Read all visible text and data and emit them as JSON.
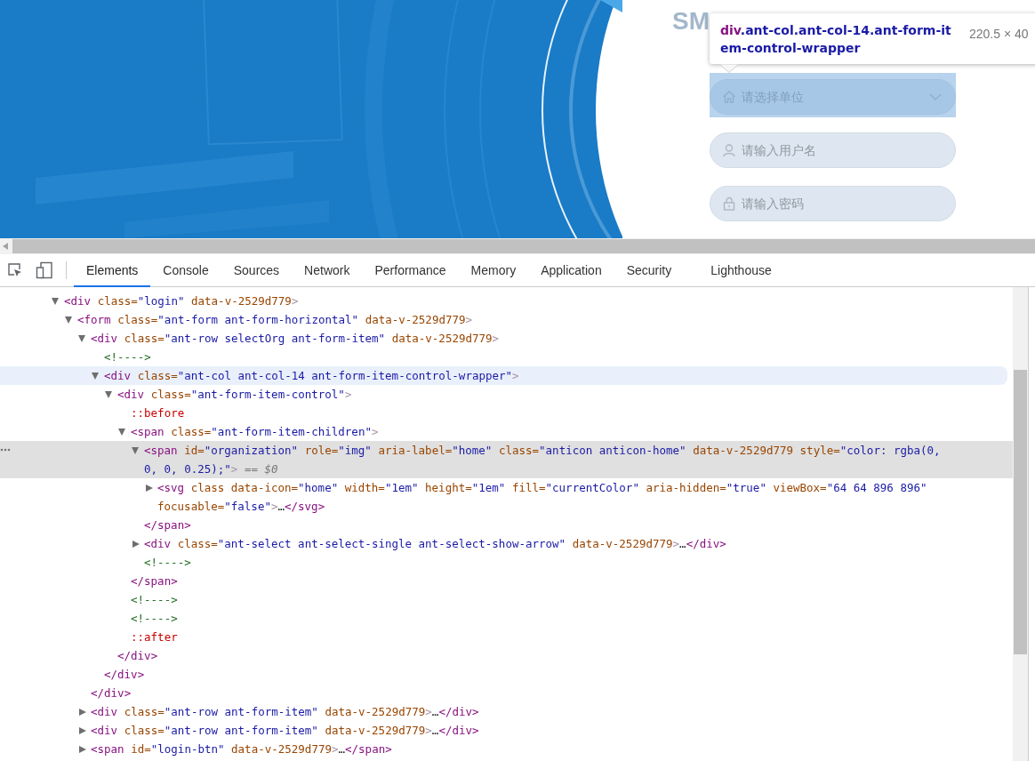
{
  "login_page": {
    "title": "SM",
    "fields": [
      {
        "kind": "select",
        "placeholder": "请选择单位"
      },
      {
        "kind": "text",
        "placeholder": "请输入用户名"
      },
      {
        "kind": "password",
        "placeholder": "请输入密码"
      }
    ]
  },
  "inspect_tooltip": {
    "tag": "div",
    "classes": ".ant-col.ant-col-14.ant-form-item-control-wrapper",
    "size": "220.5 × 40"
  },
  "devtools": {
    "tabs": [
      {
        "label": "Elements",
        "selected": true
      },
      {
        "label": "Console",
        "selected": false
      },
      {
        "label": "Sources",
        "selected": false
      },
      {
        "label": "Network",
        "selected": false
      },
      {
        "label": "Performance",
        "selected": false
      },
      {
        "label": "Memory",
        "selected": false
      },
      {
        "label": "Application",
        "selected": false
      },
      {
        "label": "Security",
        "selected": false
      },
      {
        "label": "Lighthouse",
        "selected": false
      }
    ],
    "tree": [
      {
        "expanded": true,
        "selected": false,
        "hovered": false,
        "lines": [
          [
            {
              "kind": "tag",
              "t": "<div"
            },
            {
              "kind": "attr",
              "t": " class="
            },
            {
              "kind": "val",
              "t": "\"login\""
            },
            {
              "kind": "attr",
              "t": " data-v-2529d779"
            },
            {
              "kind": "p",
              "t": ">"
            }
          ]
        ],
        "children": [
          {
            "expanded": true,
            "selected": false,
            "hovered": false,
            "lines": [
              [
                {
                  "kind": "tag",
                  "t": "<form"
                },
                {
                  "kind": "attr",
                  "t": " class="
                },
                {
                  "kind": "val",
                  "t": "\"ant-form ant-form-horizontal\""
                },
                {
                  "kind": "attr",
                  "t": " data-v-2529d779"
                },
                {
                  "kind": "p",
                  "t": ">"
                }
              ]
            ],
            "children": [
              {
                "expanded": true,
                "selected": false,
                "hovered": false,
                "lines": [
                  [
                    {
                      "kind": "tag",
                      "t": "<div"
                    },
                    {
                      "kind": "attr",
                      "t": " class="
                    },
                    {
                      "kind": "val",
                      "t": "\"ant-row selectOrg ant-form-item\""
                    },
                    {
                      "kind": "attr",
                      "t": " data-v-2529d779"
                    },
                    {
                      "kind": "p",
                      "t": ">"
                    }
                  ]
                ],
                "closing": [
                  {
                    "kind": "tag",
                    "t": "</div>"
                  }
                ],
                "children": [
                  {
                    "selected": false,
                    "hovered": false,
                    "lines": [
                      [
                        {
                          "kind": "com",
                          "t": "<!---->"
                        }
                      ]
                    ]
                  },
                  {
                    "expanded": true,
                    "selected": false,
                    "hovered": true,
                    "lines": [
                      [
                        {
                          "kind": "tag",
                          "t": "<div"
                        },
                        {
                          "kind": "attr",
                          "t": " class="
                        },
                        {
                          "kind": "val",
                          "t": "\"ant-col ant-col-14 ant-form-item-control-wrapper\""
                        },
                        {
                          "kind": "p",
                          "t": ">"
                        }
                      ]
                    ],
                    "closing": [
                      {
                        "kind": "tag",
                        "t": "</div>"
                      }
                    ],
                    "children": [
                      {
                        "expanded": true,
                        "selected": false,
                        "hovered": false,
                        "lines": [
                          [
                            {
                              "kind": "tag",
                              "t": "<div"
                            },
                            {
                              "kind": "attr",
                              "t": " class="
                            },
                            {
                              "kind": "val",
                              "t": "\"ant-form-item-control\""
                            },
                            {
                              "kind": "p",
                              "t": ">"
                            }
                          ]
                        ],
                        "closing": [
                          {
                            "kind": "tag",
                            "t": "</div>"
                          }
                        ],
                        "children": [
                          {
                            "selected": false,
                            "hovered": false,
                            "lines": [
                              [
                                {
                                  "kind": "pseudo",
                                  "t": "::before"
                                }
                              ]
                            ]
                          },
                          {
                            "expanded": true,
                            "selected": false,
                            "hovered": false,
                            "lines": [
                              [
                                {
                                  "kind": "tag",
                                  "t": "<span"
                                },
                                {
                                  "kind": "attr",
                                  "t": " class="
                                },
                                {
                                  "kind": "val",
                                  "t": "\"ant-form-item-children\""
                                },
                                {
                                  "kind": "p",
                                  "t": ">"
                                }
                              ]
                            ],
                            "closing": [
                              {
                                "kind": "tag",
                                "t": "</span>"
                              }
                            ],
                            "children": [
                              {
                                "expanded": true,
                                "selected": true,
                                "hovered": false,
                                "lines": [
                                  [
                                    {
                                      "kind": "tag",
                                      "t": "<span"
                                    },
                                    {
                                      "kind": "attr",
                                      "t": " id="
                                    },
                                    {
                                      "kind": "val",
                                      "t": "\"organization\""
                                    },
                                    {
                                      "kind": "attr",
                                      "t": " role="
                                    },
                                    {
                                      "kind": "val",
                                      "t": "\"img\""
                                    },
                                    {
                                      "kind": "attr",
                                      "t": " aria-label="
                                    },
                                    {
                                      "kind": "val",
                                      "t": "\"home\""
                                    },
                                    {
                                      "kind": "attr",
                                      "t": " class="
                                    },
                                    {
                                      "kind": "val",
                                      "t": "\"anticon anticon-home\""
                                    },
                                    {
                                      "kind": "attr",
                                      "t": " data-v-2529d779"
                                    },
                                    {
                                      "kind": "attr",
                                      "t": " style="
                                    },
                                    {
                                      "kind": "val",
                                      "t": "\"color: rgba(0,"
                                    }
                                  ],
                                  [
                                    {
                                      "kind": "val",
                                      "t": "0, 0, 0.25);\""
                                    },
                                    {
                                      "kind": "p",
                                      "t": ">"
                                    },
                                    {
                                      "kind": "ref",
                                      "t": " == $0"
                                    }
                                  ]
                                ],
                                "closing": [
                                  {
                                    "kind": "tag",
                                    "t": "</span>"
                                  }
                                ],
                                "children": [
                                  {
                                    "expanded": false,
                                    "selected": false,
                                    "hovered": false,
                                    "lines": [
                                      [
                                        {
                                          "kind": "tag",
                                          "t": "<svg"
                                        },
                                        {
                                          "kind": "attr",
                                          "t": " class data-icon="
                                        },
                                        {
                                          "kind": "val",
                                          "t": "\"home\""
                                        },
                                        {
                                          "kind": "attr",
                                          "t": " width="
                                        },
                                        {
                                          "kind": "val",
                                          "t": "\"1em\""
                                        },
                                        {
                                          "kind": "attr",
                                          "t": " height="
                                        },
                                        {
                                          "kind": "val",
                                          "t": "\"1em\""
                                        },
                                        {
                                          "kind": "attr",
                                          "t": " fill="
                                        },
                                        {
                                          "kind": "val",
                                          "t": "\"currentColor\""
                                        },
                                        {
                                          "kind": "attr",
                                          "t": " aria-hidden="
                                        },
                                        {
                                          "kind": "val",
                                          "t": "\"true\""
                                        },
                                        {
                                          "kind": "attr",
                                          "t": " viewBox="
                                        },
                                        {
                                          "kind": "val",
                                          "t": "\"64 64 896 896\""
                                        }
                                      ],
                                      [
                                        {
                                          "kind": "attr",
                                          "t": "focusable="
                                        },
                                        {
                                          "kind": "val",
                                          "t": "\"false\""
                                        },
                                        {
                                          "kind": "p",
                                          "t": ">"
                                        },
                                        {
                                          "kind": "text",
                                          "t": "…"
                                        },
                                        {
                                          "kind": "tag",
                                          "t": "</svg>"
                                        }
                                      ]
                                    ]
                                  }
                                ]
                              },
                              {
                                "expanded": false,
                                "selected": false,
                                "hovered": false,
                                "lines": [
                                  [
                                    {
                                      "kind": "tag",
                                      "t": "<div"
                                    },
                                    {
                                      "kind": "attr",
                                      "t": " class="
                                    },
                                    {
                                      "kind": "val",
                                      "t": "\"ant-select ant-select-single ant-select-show-arrow\""
                                    },
                                    {
                                      "kind": "attr",
                                      "t": " data-v-2529d779"
                                    },
                                    {
                                      "kind": "p",
                                      "t": ">"
                                    },
                                    {
                                      "kind": "text",
                                      "t": "…"
                                    },
                                    {
                                      "kind": "tag",
                                      "t": "</div>"
                                    }
                                  ]
                                ]
                              },
                              {
                                "selected": false,
                                "hovered": false,
                                "lines": [
                                  [
                                    {
                                      "kind": "com",
                                      "t": "<!---->"
                                    }
                                  ]
                                ]
                              }
                            ]
                          },
                          {
                            "selected": false,
                            "hovered": false,
                            "lines": [
                              [
                                {
                                  "kind": "com",
                                  "t": "<!---->"
                                }
                              ]
                            ]
                          },
                          {
                            "selected": false,
                            "hovered": false,
                            "lines": [
                              [
                                {
                                  "kind": "com",
                                  "t": "<!---->"
                                }
                              ]
                            ]
                          },
                          {
                            "selected": false,
                            "hovered": false,
                            "lines": [
                              [
                                {
                                  "kind": "pseudo",
                                  "t": "::after"
                                }
                              ]
                            ]
                          }
                        ]
                      }
                    ]
                  }
                ]
              },
              {
                "expanded": false,
                "selected": false,
                "hovered": false,
                "lines": [
                  [
                    {
                      "kind": "tag",
                      "t": "<div"
                    },
                    {
                      "kind": "attr",
                      "t": " class="
                    },
                    {
                      "kind": "val",
                      "t": "\"ant-row ant-form-item\""
                    },
                    {
                      "kind": "attr",
                      "t": " data-v-2529d779"
                    },
                    {
                      "kind": "p",
                      "t": ">"
                    },
                    {
                      "kind": "text",
                      "t": "…"
                    },
                    {
                      "kind": "tag",
                      "t": "</div>"
                    }
                  ]
                ]
              },
              {
                "expanded": false,
                "selected": false,
                "hovered": false,
                "lines": [
                  [
                    {
                      "kind": "tag",
                      "t": "<div"
                    },
                    {
                      "kind": "attr",
                      "t": " class="
                    },
                    {
                      "kind": "val",
                      "t": "\"ant-row ant-form-item\""
                    },
                    {
                      "kind": "attr",
                      "t": " data-v-2529d779"
                    },
                    {
                      "kind": "p",
                      "t": ">"
                    },
                    {
                      "kind": "text",
                      "t": "…"
                    },
                    {
                      "kind": "tag",
                      "t": "</div>"
                    }
                  ]
                ]
              },
              {
                "expanded": false,
                "selected": false,
                "hovered": false,
                "lines": [
                  [
                    {
                      "kind": "tag",
                      "t": "<span"
                    },
                    {
                      "kind": "attr",
                      "t": " id="
                    },
                    {
                      "kind": "val",
                      "t": "\"login-btn\""
                    },
                    {
                      "kind": "attr",
                      "t": " data-v-2529d779"
                    },
                    {
                      "kind": "p",
                      "t": ">"
                    },
                    {
                      "kind": "text",
                      "t": "…"
                    },
                    {
                      "kind": "tag",
                      "t": "</span>"
                    }
                  ]
                ]
              }
            ]
          }
        ]
      }
    ]
  }
}
